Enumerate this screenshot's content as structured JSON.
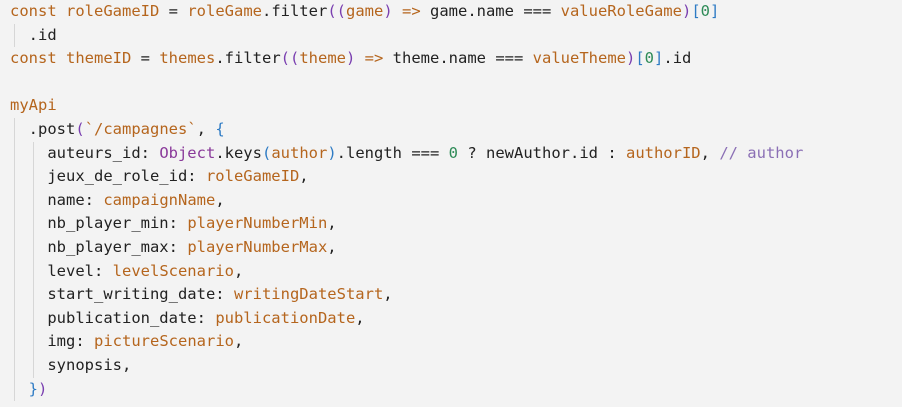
{
  "code": {
    "lines": [
      {
        "indent": 0,
        "segments": [
          {
            "t": "const ",
            "c": "kw"
          },
          {
            "t": "roleGameID",
            "c": "var"
          },
          {
            "t": " = ",
            "c": "text"
          },
          {
            "t": "roleGame",
            "c": "var"
          },
          {
            "t": ".filter",
            "c": "text"
          },
          {
            "t": "((",
            "c": "paren"
          },
          {
            "t": "game",
            "c": "var"
          },
          {
            "t": ") ",
            "c": "paren"
          },
          {
            "t": "=>",
            "c": "kw"
          },
          {
            "t": " game.name ",
            "c": "text"
          },
          {
            "t": "===",
            "c": "text"
          },
          {
            "t": " valueRoleGame",
            "c": "var"
          },
          {
            "t": ")",
            "c": "paren"
          },
          {
            "t": "[",
            "c": "brace"
          },
          {
            "t": "0",
            "c": "num"
          },
          {
            "t": "]",
            "c": "brace"
          }
        ]
      },
      {
        "indent": 1,
        "segments": [
          {
            "t": ".id",
            "c": "text"
          }
        ]
      },
      {
        "indent": 0,
        "segments": [
          {
            "t": "const ",
            "c": "kw"
          },
          {
            "t": "themeID",
            "c": "var"
          },
          {
            "t": " = ",
            "c": "text"
          },
          {
            "t": "themes",
            "c": "var"
          },
          {
            "t": ".filter",
            "c": "text"
          },
          {
            "t": "((",
            "c": "paren"
          },
          {
            "t": "theme",
            "c": "var"
          },
          {
            "t": ") ",
            "c": "paren"
          },
          {
            "t": "=>",
            "c": "kw"
          },
          {
            "t": " theme.name ",
            "c": "text"
          },
          {
            "t": "===",
            "c": "text"
          },
          {
            "t": " valueTheme",
            "c": "var"
          },
          {
            "t": ")",
            "c": "paren"
          },
          {
            "t": "[",
            "c": "brace"
          },
          {
            "t": "0",
            "c": "num"
          },
          {
            "t": "]",
            "c": "brace"
          },
          {
            "t": ".id",
            "c": "text"
          }
        ]
      },
      {
        "indent": 0,
        "segments": []
      },
      {
        "indent": 0,
        "segments": [
          {
            "t": "myApi",
            "c": "var"
          }
        ]
      },
      {
        "indent": 1,
        "segments": [
          {
            "t": ".post",
            "c": "text"
          },
          {
            "t": "(",
            "c": "paren"
          },
          {
            "t": "`/campagnes`",
            "c": "str"
          },
          {
            "t": ", ",
            "c": "text"
          },
          {
            "t": "{",
            "c": "brace"
          }
        ]
      },
      {
        "indent": 2,
        "segments": [
          {
            "t": "auteurs_id: ",
            "c": "prop"
          },
          {
            "t": "Object",
            "c": "obj"
          },
          {
            "t": ".keys",
            "c": "text"
          },
          {
            "t": "(",
            "c": "paren2"
          },
          {
            "t": "author",
            "c": "var"
          },
          {
            "t": ")",
            "c": "paren2"
          },
          {
            "t": ".length ",
            "c": "text"
          },
          {
            "t": "===",
            "c": "text"
          },
          {
            "t": " 0 ",
            "c": "num"
          },
          {
            "t": "? ",
            "c": "text"
          },
          {
            "t": "newAuthor.id : ",
            "c": "text"
          },
          {
            "t": "authorID",
            "c": "var"
          },
          {
            "t": ", ",
            "c": "text"
          },
          {
            "t": "// author",
            "c": "comment"
          }
        ]
      },
      {
        "indent": 2,
        "segments": [
          {
            "t": "jeux_de_role_id: ",
            "c": "prop"
          },
          {
            "t": "roleGameID",
            "c": "val"
          },
          {
            "t": ",",
            "c": "text"
          }
        ]
      },
      {
        "indent": 2,
        "segments": [
          {
            "t": "name: ",
            "c": "prop"
          },
          {
            "t": "campaignName",
            "c": "val"
          },
          {
            "t": ",",
            "c": "text"
          }
        ]
      },
      {
        "indent": 2,
        "segments": [
          {
            "t": "nb_player_min: ",
            "c": "prop"
          },
          {
            "t": "playerNumberMin",
            "c": "val"
          },
          {
            "t": ",",
            "c": "text"
          }
        ]
      },
      {
        "indent": 2,
        "segments": [
          {
            "t": "nb_player_max: ",
            "c": "prop"
          },
          {
            "t": "playerNumberMax",
            "c": "val"
          },
          {
            "t": ",",
            "c": "text"
          }
        ]
      },
      {
        "indent": 2,
        "segments": [
          {
            "t": "level: ",
            "c": "prop"
          },
          {
            "t": "levelScenario",
            "c": "val"
          },
          {
            "t": ",",
            "c": "text"
          }
        ]
      },
      {
        "indent": 2,
        "segments": [
          {
            "t": "start_writing_date: ",
            "c": "prop"
          },
          {
            "t": "writingDateStart",
            "c": "val"
          },
          {
            "t": ",",
            "c": "text"
          }
        ]
      },
      {
        "indent": 2,
        "segments": [
          {
            "t": "publication_date: ",
            "c": "prop"
          },
          {
            "t": "publicationDate",
            "c": "val"
          },
          {
            "t": ",",
            "c": "text"
          }
        ]
      },
      {
        "indent": 2,
        "segments": [
          {
            "t": "img: ",
            "c": "prop"
          },
          {
            "t": "pictureScenario",
            "c": "val"
          },
          {
            "t": ",",
            "c": "text"
          }
        ]
      },
      {
        "indent": 2,
        "segments": [
          {
            "t": "synopsis,",
            "c": "prop"
          }
        ]
      },
      {
        "indent": 1,
        "segments": [
          {
            "t": "}",
            "c": "brace"
          },
          {
            "t": ")",
            "c": "paren"
          }
        ]
      }
    ]
  }
}
